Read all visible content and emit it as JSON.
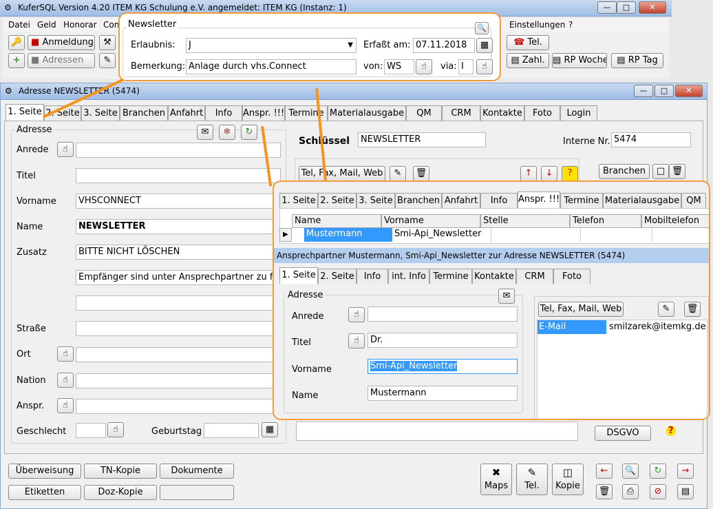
{
  "app": {
    "title": "KuferSQL Version 4.20   ITEM KG Schulung e.V.  angemeldet: ITEM KG (Instanz: 1)",
    "menu": [
      "Datei",
      "Geld",
      "Honorar",
      "Con"
    ],
    "menu_right": [
      "Einstellungen",
      "?"
    ],
    "toolbar1": {
      "anmeldung": "Anmeldung",
      "tel": "Tel.",
      "zahl": "Zahl.",
      "rp_woche": "RP Woche",
      "rp_tag": "RP Tag"
    },
    "toolbar2": {
      "adressen": "Adressen"
    }
  },
  "newsletter": {
    "title": "Newsletter",
    "erlaubnis_label": "Erlaubnis:",
    "erlaubnis_value": "J",
    "erfasst_label": "Erfaßt am:",
    "erfasst_value": "07.11.2018",
    "bemerkung_label": "Bemerkung:",
    "bemerkung_value": "Anlage durch vhs.Connect",
    "von_label": "von:",
    "von_value": "WS",
    "via_label": "via:",
    "via_value": "I"
  },
  "address_window": {
    "title": "Adresse NEWSLETTER (5474)",
    "tabs": [
      "1. Seite",
      "2. Seite",
      "3. Seite",
      "Branchen",
      "Anfahrt",
      "Info",
      "Anspr. !!!",
      "Termine",
      "Materialausgabe",
      "QM",
      "CRM",
      "Kontakte",
      "Foto",
      "Login"
    ],
    "group_label": "Adresse",
    "labels": {
      "anrede": "Anrede",
      "titel": "Titel",
      "vorname": "Vorname",
      "name": "Name",
      "zusatz": "Zusatz",
      "strasse": "Straße",
      "ort": "Ort",
      "nation": "Nation",
      "anspr": "Anspr.",
      "geschlecht": "Geschlecht",
      "geburtstag": "Geburtstag"
    },
    "values": {
      "vorname": "VHSCONNECT",
      "name": "NEWSLETTER",
      "zusatz1": "BITTE NICHT LÖSCHEN",
      "zusatz2": "Empfänger sind unter Ansprechpartner zu finden"
    },
    "schluessel_label": "Schlüssel",
    "schluessel_value": "NEWSLETTER",
    "interne_label": "Interne Nr.",
    "interne_value": "5474",
    "tel_btn": "Tel, Fax, Mail, Web",
    "branchen_btn": "Branchen",
    "dsgvo_btn": "DSGVO",
    "bottom": {
      "ueberweisung": "Überweisung",
      "tn_kopie": "TN-Kopie",
      "dokumente": "Dokumente",
      "etiketten": "Etiketten",
      "doz_kopie": "Doz-Kopie",
      "maps": "Maps",
      "tel": "Tel.",
      "kopie": "Kopie"
    }
  },
  "contact_popup": {
    "tabs": [
      "1. Seite",
      "2. Seite",
      "3. Seite",
      "Branchen",
      "Anfahrt",
      "Info",
      "Anspr. !!!",
      "Termine",
      "Materialausgabe",
      "QM"
    ],
    "grid_headers": [
      "Name",
      "Vorname",
      "Stelle",
      "Telefon",
      "Mobiltelefon"
    ],
    "grid_row": {
      "name": "Mustermann",
      "vorname": "Smi-Api_Newsletter",
      "stelle": "",
      "telefon": "",
      "mobil": ""
    },
    "status": "Ansprechpartner Mustermann, Smi-Api_Newsletter zur Adresse NEWSLETTER (5474)",
    "subtabs": [
      "1. Seite",
      "2. Seite",
      "Info",
      "int. Info",
      "Termine",
      "Kontakte",
      "CRM",
      "Foto"
    ],
    "group_label": "Adresse",
    "labels": {
      "anrede": "Anrede",
      "titel": "Titel",
      "vorname": "Vorname",
      "name": "Name"
    },
    "values": {
      "titel": "Dr.",
      "vorname": "Smi-Api_Newsletter",
      "name": "Mustermann"
    },
    "tel_btn": "Tel, Fax, Mail, Web",
    "comm": {
      "type": "E-Mail",
      "value": "smilzarek@itemkg.de"
    }
  },
  "colors": {
    "highlight": "#3399ff",
    "callout": "#f7941d",
    "titlebar": "#b3cdee"
  }
}
